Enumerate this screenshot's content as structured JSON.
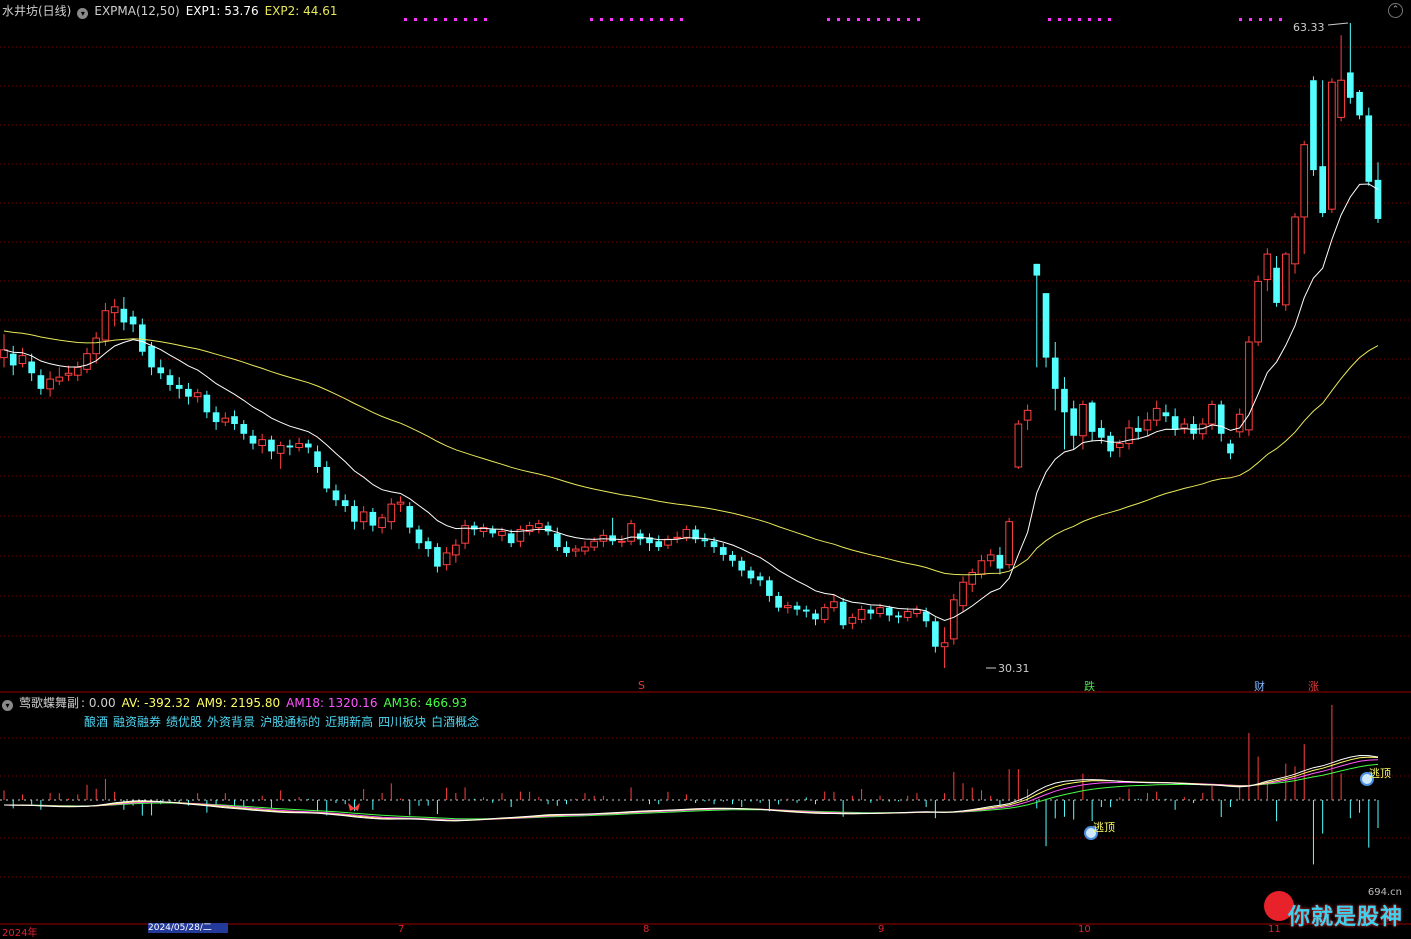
{
  "main_header": {
    "stock": "水井坊(日线)",
    "indicator": "EXPMA(12,50)",
    "exp1_label": "EXP1: 53.76",
    "exp2_label": "EXP2: 44.61"
  },
  "sub_header": {
    "indicator": "莺歌蝶舞副",
    "value": ": 0.00",
    "av_label": "AV: -392.32",
    "am9_label": "AM9: 2195.80",
    "am18_label": "AM18: 1320.16",
    "am36_label": "AM36: 466.93"
  },
  "concepts": [
    "酿酒",
    "融资融券",
    "绩优股",
    "外资背景",
    "沪股通标的",
    "近期新高",
    "四川板块",
    "白酒概念"
  ],
  "price_labels": {
    "high": "63.33",
    "low": "30.31"
  },
  "event_markers": [
    {
      "text": "S",
      "color": "#e23b3b"
    },
    {
      "text": "跌",
      "color": "#4de04d"
    },
    {
      "text": "财",
      "color": "#7fb8ff"
    },
    {
      "text": "涨",
      "color": "#e23b3b"
    }
  ],
  "signals": {
    "top1": "逃顶",
    "top2": "逃顶"
  },
  "x_axis": {
    "year": "2024年",
    "date_box": "2024/05/28/二",
    "m7": "7",
    "m8": "8",
    "m9": "9",
    "m10": "10",
    "m11": "11"
  },
  "watermark": {
    "site": "694.cn",
    "text": "你就是股神"
  },
  "colors": {
    "up": "#ff4040",
    "down": "#54ffff",
    "exp1": "#ffffff",
    "exp2": "#e8e85a",
    "av": "#ffffff",
    "am9": "#ffff66",
    "am18": "#ff55ff",
    "am36": "#44ff44",
    "grid": "#7a0000",
    "top_dots": "#ff33ff"
  },
  "chart_data": {
    "type": "candlestick",
    "period": "daily",
    "price_range": [
      30.31,
      63.33
    ],
    "candles": [
      [
        46.2,
        46.6,
        47.4,
        45.7
      ],
      [
        46.4,
        45.8,
        46.8,
        45.3
      ],
      [
        45.9,
        46.3,
        46.7,
        45.7
      ],
      [
        46.0,
        45.4,
        46.4,
        45.0
      ],
      [
        45.3,
        44.6,
        45.6,
        44.3
      ],
      [
        44.6,
        45.1,
        45.5,
        44.2
      ],
      [
        45.0,
        45.2,
        45.7,
        44.8
      ],
      [
        45.3,
        45.4,
        45.8,
        45.0
      ],
      [
        45.3,
        45.7,
        46.0,
        45.0
      ],
      [
        45.6,
        46.4,
        46.7,
        45.4
      ],
      [
        46.4,
        47.2,
        47.5,
        45.9
      ],
      [
        47.1,
        48.6,
        49.0,
        46.8
      ],
      [
        48.5,
        48.8,
        49.2,
        47.8
      ],
      [
        48.7,
        48.0,
        49.3,
        47.6
      ],
      [
        48.3,
        47.9,
        48.6,
        47.5
      ],
      [
        47.9,
        46.5,
        48.2,
        46.3
      ],
      [
        46.8,
        45.7,
        47.0,
        45.3
      ],
      [
        45.7,
        45.4,
        46.1,
        45.1
      ],
      [
        45.3,
        44.8,
        45.6,
        44.5
      ],
      [
        44.8,
        44.6,
        45.2,
        44.1
      ],
      [
        44.6,
        44.2,
        44.9,
        43.8
      ],
      [
        44.2,
        44.4,
        44.6,
        43.9
      ],
      [
        44.3,
        43.4,
        44.5,
        43.1
      ],
      [
        43.4,
        42.9,
        43.7,
        42.5
      ],
      [
        42.9,
        43.1,
        43.4,
        42.7
      ],
      [
        43.2,
        42.8,
        43.5,
        42.5
      ],
      [
        42.8,
        42.3,
        43.0,
        42.0
      ],
      [
        42.2,
        41.8,
        42.5,
        41.5
      ],
      [
        41.7,
        42.0,
        42.3,
        41.3
      ],
      [
        42.0,
        41.4,
        42.2,
        41.0
      ],
      [
        41.3,
        41.7,
        41.9,
        40.5
      ],
      [
        41.7,
        41.6,
        42.0,
        41.2
      ],
      [
        41.6,
        41.8,
        42.1,
        41.4
      ],
      [
        41.8,
        41.6,
        42.0,
        41.3
      ],
      [
        41.4,
        40.6,
        41.7,
        40.3
      ],
      [
        40.6,
        39.5,
        40.9,
        39.3
      ],
      [
        39.4,
        38.9,
        39.7,
        38.6
      ],
      [
        38.9,
        38.6,
        39.2,
        38.3
      ],
      [
        38.6,
        37.8,
        38.9,
        37.4
      ],
      [
        37.8,
        38.3,
        38.6,
        37.4
      ],
      [
        38.3,
        37.6,
        38.5,
        37.3
      ],
      [
        37.5,
        38.0,
        38.2,
        37.2
      ],
      [
        37.8,
        38.7,
        39.0,
        37.4
      ],
      [
        38.7,
        38.8,
        39.1,
        38.3
      ],
      [
        38.6,
        37.5,
        38.8,
        37.2
      ],
      [
        37.4,
        36.7,
        37.6,
        36.4
      ],
      [
        36.8,
        36.4,
        37.0,
        36.0
      ],
      [
        36.5,
        35.5,
        36.7,
        35.2
      ],
      [
        35.6,
        36.2,
        36.5,
        35.3
      ],
      [
        36.1,
        36.6,
        36.9,
        35.7
      ],
      [
        36.7,
        37.6,
        37.9,
        36.4
      ],
      [
        37.6,
        37.4,
        37.8,
        37.1
      ],
      [
        37.3,
        37.5,
        37.7,
        37.0
      ],
      [
        37.4,
        37.2,
        37.6,
        37.0
      ],
      [
        37.1,
        37.3,
        37.5,
        36.8
      ],
      [
        37.2,
        36.7,
        37.4,
        36.5
      ],
      [
        36.8,
        37.4,
        37.6,
        36.5
      ],
      [
        37.3,
        37.6,
        37.8,
        37.1
      ],
      [
        37.5,
        37.7,
        37.9,
        37.2
      ],
      [
        37.6,
        37.3,
        37.8,
        37.1
      ],
      [
        37.2,
        36.5,
        37.5,
        36.3
      ],
      [
        36.5,
        36.2,
        36.8,
        36.0
      ],
      [
        36.3,
        36.4,
        36.6,
        36.0
      ],
      [
        36.3,
        36.5,
        36.8,
        36.1
      ],
      [
        36.5,
        36.8,
        37.0,
        36.3
      ],
      [
        36.8,
        37.1,
        37.4,
        36.5
      ],
      [
        37.1,
        36.8,
        38.0,
        36.6
      ],
      [
        36.8,
        36.8,
        37.1,
        36.5
      ],
      [
        36.8,
        37.7,
        37.9,
        36.6
      ],
      [
        37.2,
        36.9,
        37.4,
        36.6
      ],
      [
        37.0,
        36.7,
        37.2,
        36.3
      ],
      [
        36.8,
        36.5,
        37.1,
        36.3
      ],
      [
        36.6,
        36.9,
        37.1,
        36.4
      ],
      [
        37.0,
        37.0,
        37.3,
        36.7
      ],
      [
        37.0,
        37.4,
        37.6,
        36.8
      ],
      [
        37.4,
        36.9,
        37.6,
        36.7
      ],
      [
        36.9,
        36.8,
        37.2,
        36.5
      ],
      [
        36.8,
        36.5,
        37.0,
        36.2
      ],
      [
        36.5,
        36.1,
        36.7,
        35.8
      ],
      [
        36.1,
        35.8,
        36.3,
        35.5
      ],
      [
        35.8,
        35.3,
        36.0,
        35.0
      ],
      [
        35.3,
        34.9,
        35.5,
        34.6
      ],
      [
        35.0,
        34.8,
        35.2,
        34.5
      ],
      [
        34.8,
        34.0,
        35.0,
        33.7
      ],
      [
        34.0,
        33.4,
        34.2,
        33.2
      ],
      [
        33.4,
        33.5,
        33.7,
        33.1
      ],
      [
        33.5,
        33.3,
        33.7,
        33.0
      ],
      [
        33.3,
        33.2,
        33.5,
        32.9
      ],
      [
        33.1,
        32.8,
        33.3,
        32.5
      ],
      [
        32.8,
        33.4,
        33.6,
        32.6
      ],
      [
        33.4,
        33.7,
        34.1,
        33.2
      ],
      [
        33.7,
        32.5,
        33.9,
        32.3
      ],
      [
        32.6,
        32.9,
        33.1,
        32.3
      ],
      [
        32.8,
        33.3,
        33.5,
        32.6
      ],
      [
        33.3,
        33.1,
        33.5,
        32.8
      ],
      [
        33.1,
        33.4,
        33.6,
        32.9
      ],
      [
        33.4,
        33.0,
        33.5,
        32.7
      ],
      [
        33.0,
        32.9,
        33.2,
        32.6
      ],
      [
        32.9,
        33.2,
        33.4,
        32.7
      ],
      [
        33.1,
        33.3,
        33.5,
        32.9
      ],
      [
        33.2,
        32.7,
        33.4,
        32.4
      ],
      [
        32.7,
        31.4,
        32.9,
        31.1
      ],
      [
        31.4,
        31.6,
        32.4,
        30.31
      ],
      [
        31.8,
        33.8,
        34.1,
        31.5
      ],
      [
        33.5,
        34.7,
        35.0,
        33.2
      ],
      [
        34.6,
        35.2,
        35.4,
        34.2
      ],
      [
        35.1,
        35.8,
        36.1,
        34.9
      ],
      [
        35.8,
        36.1,
        36.4,
        35.5
      ],
      [
        36.1,
        35.4,
        36.5,
        35.1
      ],
      [
        35.6,
        37.8,
        38.0,
        35.4
      ],
      [
        40.6,
        42.8,
        43.0,
        40.5
      ],
      [
        43.0,
        43.5,
        43.8,
        42.5
      ],
      [
        51.0,
        50.4,
        51.0,
        45.7
      ],
      [
        49.5,
        46.2,
        49.5,
        45.7
      ],
      [
        46.2,
        44.6,
        47.0,
        43.5
      ],
      [
        44.6,
        43.4,
        45.2,
        41.5
      ],
      [
        43.6,
        42.2,
        44.0,
        41.5
      ],
      [
        42.2,
        43.8,
        44.0,
        41.5
      ],
      [
        43.9,
        42.4,
        44.0,
        41.9
      ],
      [
        42.6,
        42.1,
        43.0,
        41.8
      ],
      [
        42.2,
        41.4,
        42.4,
        41.1
      ],
      [
        41.6,
        41.8,
        42.0,
        41.1
      ],
      [
        41.8,
        42.6,
        43.0,
        41.5
      ],
      [
        42.6,
        42.4,
        43.2,
        42.0
      ],
      [
        42.5,
        43.0,
        43.4,
        42.2
      ],
      [
        43.0,
        43.6,
        44.0,
        42.7
      ],
      [
        43.4,
        43.2,
        43.8,
        42.9
      ],
      [
        43.2,
        42.5,
        43.6,
        42.2
      ],
      [
        42.6,
        42.8,
        43.1,
        42.3
      ],
      [
        42.8,
        42.3,
        43.2,
        42.0
      ],
      [
        42.3,
        42.8,
        43.1,
        42.0
      ],
      [
        42.8,
        43.8,
        44.0,
        42.5
      ],
      [
        43.8,
        42.3,
        44.0,
        41.9
      ],
      [
        41.8,
        41.3,
        42.0,
        41.0
      ],
      [
        42.4,
        43.3,
        43.6,
        42.1
      ],
      [
        42.5,
        47.0,
        47.3,
        42.2
      ],
      [
        47.0,
        50.1,
        50.4,
        46.8
      ],
      [
        50.2,
        51.5,
        51.8,
        49.6
      ],
      [
        50.8,
        49.0,
        51.4,
        48.8
      ],
      [
        48.9,
        51.5,
        51.6,
        48.6
      ],
      [
        51.0,
        53.4,
        53.6,
        50.5
      ],
      [
        53.4,
        57.1,
        57.3,
        51.5
      ],
      [
        60.4,
        55.8,
        60.6,
        55.5
      ],
      [
        56.0,
        53.6,
        60.4,
        53.4
      ],
      [
        53.8,
        60.3,
        60.5,
        53.6
      ],
      [
        58.5,
        60.4,
        62.7,
        58.3
      ],
      [
        60.8,
        59.5,
        63.33,
        59.2
      ],
      [
        59.8,
        58.6,
        59.9,
        58.4
      ],
      [
        58.6,
        55.2,
        59.0,
        55.0
      ],
      [
        55.3,
        53.3,
        56.2,
        53.1
      ]
    ]
  }
}
